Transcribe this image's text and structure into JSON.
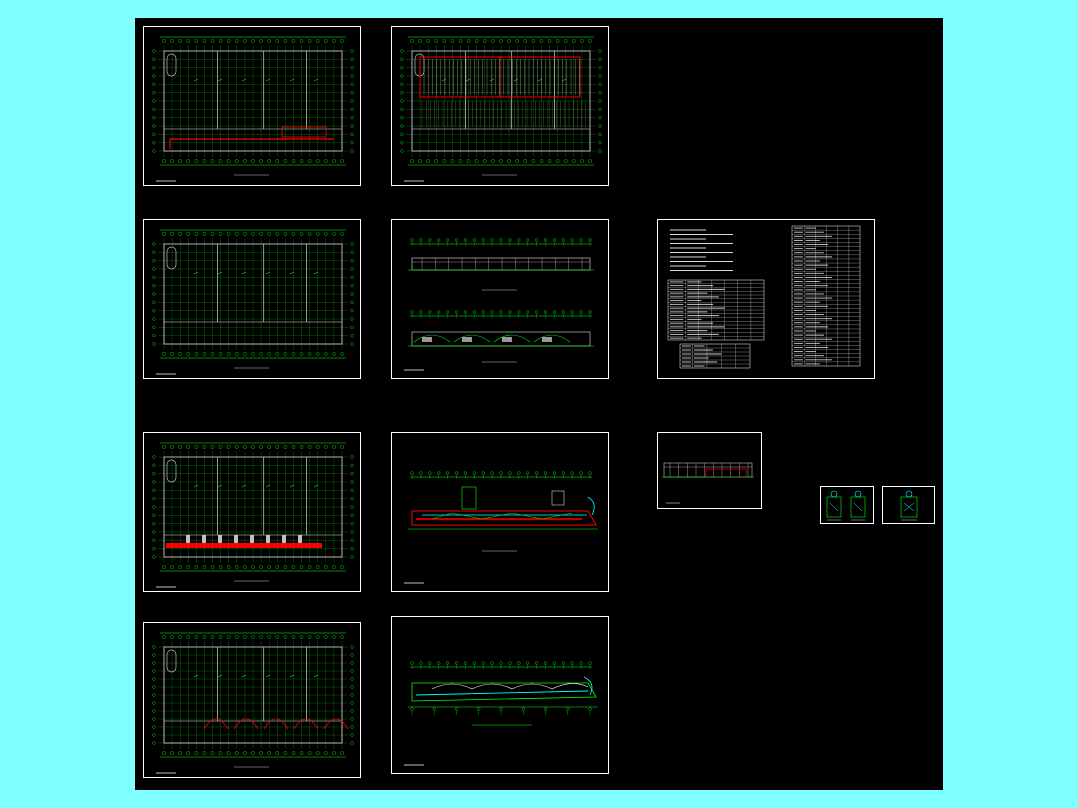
{
  "colors": {
    "background": "#7fffff",
    "canvas": "#000000",
    "frame": "#ffffff",
    "grid": "#00ff00",
    "accent": "#ff0000",
    "pipe": "#00ffff",
    "wall": "#c0c0c0"
  },
  "sheets": [
    {
      "id": "plan-1",
      "kind": "plan"
    },
    {
      "id": "plan-2",
      "kind": "plan-seats"
    },
    {
      "id": "plan-3",
      "kind": "plan"
    },
    {
      "id": "elevations",
      "kind": "elevation"
    },
    {
      "id": "schedules",
      "kind": "table"
    },
    {
      "id": "plan-4",
      "kind": "plan"
    },
    {
      "id": "section-1",
      "kind": "section"
    },
    {
      "id": "section-small",
      "kind": "section-small"
    },
    {
      "id": "detail-1",
      "kind": "detail"
    },
    {
      "id": "detail-2",
      "kind": "detail"
    },
    {
      "id": "plan-5",
      "kind": "plan"
    },
    {
      "id": "section-2",
      "kind": "section"
    }
  ]
}
